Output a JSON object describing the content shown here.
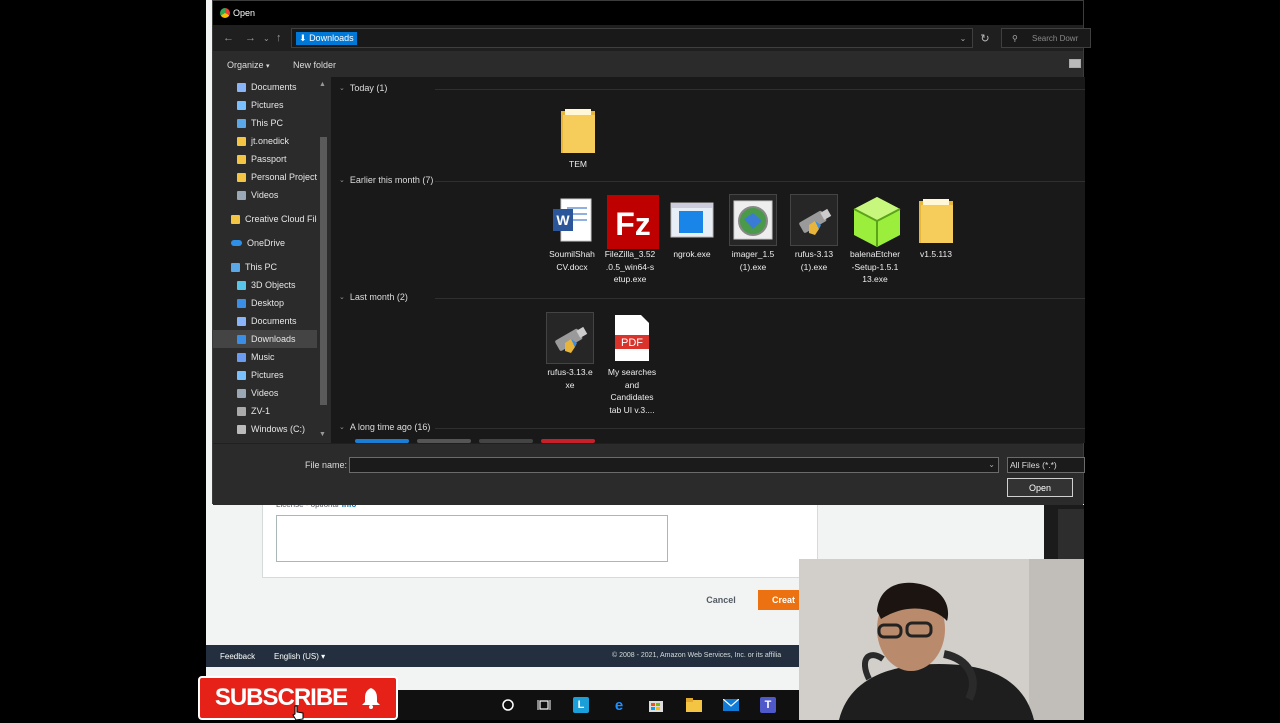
{
  "dialog": {
    "title": "Open",
    "address": {
      "path": "Downloads",
      "search_placeholder": "Search Dowr"
    },
    "toolbar": {
      "organize": "Organize",
      "new_folder": "New folder"
    },
    "sidebar": [
      {
        "label": "Documents",
        "icon": "document-icon",
        "pinned": true
      },
      {
        "label": "Pictures",
        "icon": "pictures-icon",
        "pinned": true
      },
      {
        "label": "This PC",
        "icon": "pc-icon",
        "pinned": true
      },
      {
        "label": "jt.onedick",
        "icon": "folder-icon"
      },
      {
        "label": "Passport",
        "icon": "folder-icon"
      },
      {
        "label": "Personal Projects",
        "icon": "folder-icon"
      },
      {
        "label": "Videos",
        "icon": "videos-icon"
      },
      {
        "label": "Creative Cloud File",
        "icon": "folder-icon"
      },
      {
        "label": "OneDrive",
        "icon": "onedrive-icon"
      },
      {
        "label": "This PC",
        "icon": "pc-icon"
      },
      {
        "label": "3D Objects",
        "icon": "cube-icon"
      },
      {
        "label": "Desktop",
        "icon": "desktop-icon"
      },
      {
        "label": "Documents",
        "icon": "document-icon"
      },
      {
        "label": "Downloads",
        "icon": "download-icon",
        "selected": true
      },
      {
        "label": "Music",
        "icon": "music-icon"
      },
      {
        "label": "Pictures",
        "icon": "pictures-icon"
      },
      {
        "label": "Videos",
        "icon": "videos-icon"
      },
      {
        "label": "ZV-1",
        "icon": "camera-icon"
      },
      {
        "label": "Windows (C:)",
        "icon": "drive-icon"
      }
    ],
    "groups": [
      {
        "header": "Today (1)",
        "files": [
          {
            "name": "TEM",
            "icon": "folder-icon"
          }
        ]
      },
      {
        "header": "Earlier this month (7)",
        "files": [
          {
            "name": "SoumilShah CV.docx",
            "icon": "word-icon"
          },
          {
            "name": "FileZilla_3.52.0.5_win64-setup.exe",
            "icon": "filezilla-icon"
          },
          {
            "name": "ngrok.exe",
            "icon": "ngrok-icon"
          },
          {
            "name": "imager_1.5 (1).exe",
            "icon": "imager-icon"
          },
          {
            "name": "rufus-3.13 (1).exe",
            "icon": "usb-icon"
          },
          {
            "name": "balenaEtcher-Setup-1.5.113.exe",
            "icon": "etcher-icon"
          },
          {
            "name": "v1.5.113",
            "icon": "folder-icon"
          }
        ]
      },
      {
        "header": "Last month (2)",
        "files": [
          {
            "name": "rufus-3.13.exe",
            "icon": "usb-icon"
          },
          {
            "name": "My searches and Candidates tab UI v.3....",
            "icon": "pdf-icon"
          }
        ]
      },
      {
        "header": "A long time ago (16)",
        "files": []
      }
    ],
    "file_display": [
      "TEM",
      "SoumilShah\nCV.docx",
      "FileZilla_3.52\n.0.5_win64-s\netup.exe",
      "ngrok.exe",
      "imager_1.5\n(1).exe",
      "rufus-3.13\n(1).exe",
      "balenaEtcher\n-Setup-1.5.1\n13.exe",
      "v1.5.113",
      "rufus-3.13.e\nxe",
      "My searches\nand\nCandidates\ntab UI v.3...."
    ],
    "pdf_label": "PDF",
    "file_name_label": "File name:",
    "file_name_value": "",
    "filter": "All Files (*.*)",
    "open_button": "Open"
  },
  "background_page": {
    "license_label": "License - optional",
    "license_info": "Info",
    "cancel": "Cancel",
    "create": "Creat",
    "footer": {
      "feedback": "Feedback",
      "language": "English (US)",
      "copyright": "© 2008 - 2021, Amazon Web Services, Inc. or its affilia"
    }
  },
  "overlay": {
    "subscribe": "SUBSCRIBE"
  },
  "colors": {
    "selection": "#0078d7",
    "aws_orange": "#ec7211",
    "subscribe_red": "#e62117",
    "dialog_bg": "#2b2b2b",
    "content_bg": "#191919"
  }
}
